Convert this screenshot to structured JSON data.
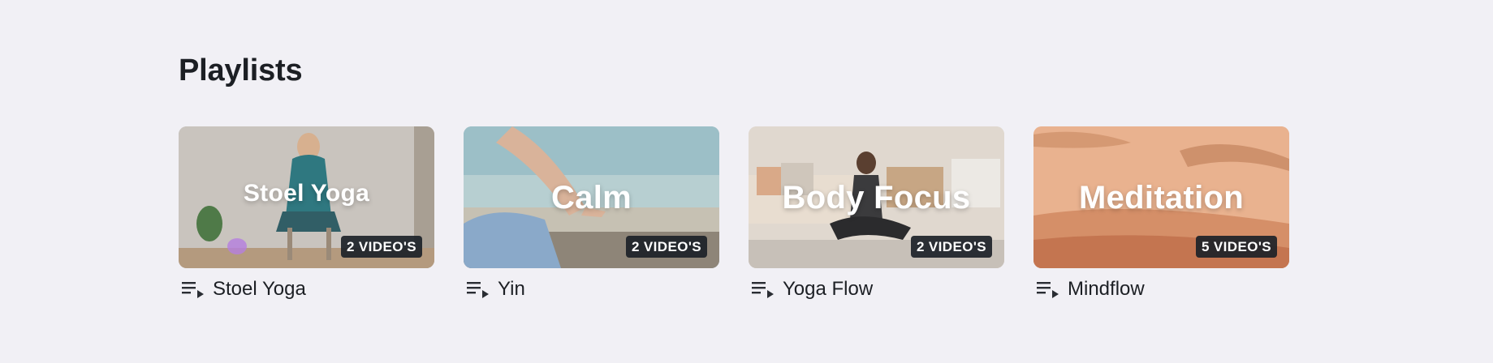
{
  "page": {
    "title": "Playlists"
  },
  "colors": {
    "background": "#f1f0f5",
    "text": "#1c1f24",
    "badge": "#1c2228"
  },
  "playlists": [
    {
      "thumb_title": "Stoel Yoga",
      "count": "2 VIDEO'S",
      "name": "Stoel Yoga",
      "icon": "playlist-icon"
    },
    {
      "thumb_title": "Calm",
      "count": "2 VIDEO'S",
      "name": "Yin",
      "icon": "playlist-icon"
    },
    {
      "thumb_title": "Body Focus",
      "count": "2 VIDEO'S",
      "name": "Yoga Flow",
      "icon": "playlist-icon"
    },
    {
      "thumb_title": "Meditation",
      "count": "5 VIDEO'S",
      "name": "Mindflow",
      "icon": "playlist-icon"
    }
  ]
}
